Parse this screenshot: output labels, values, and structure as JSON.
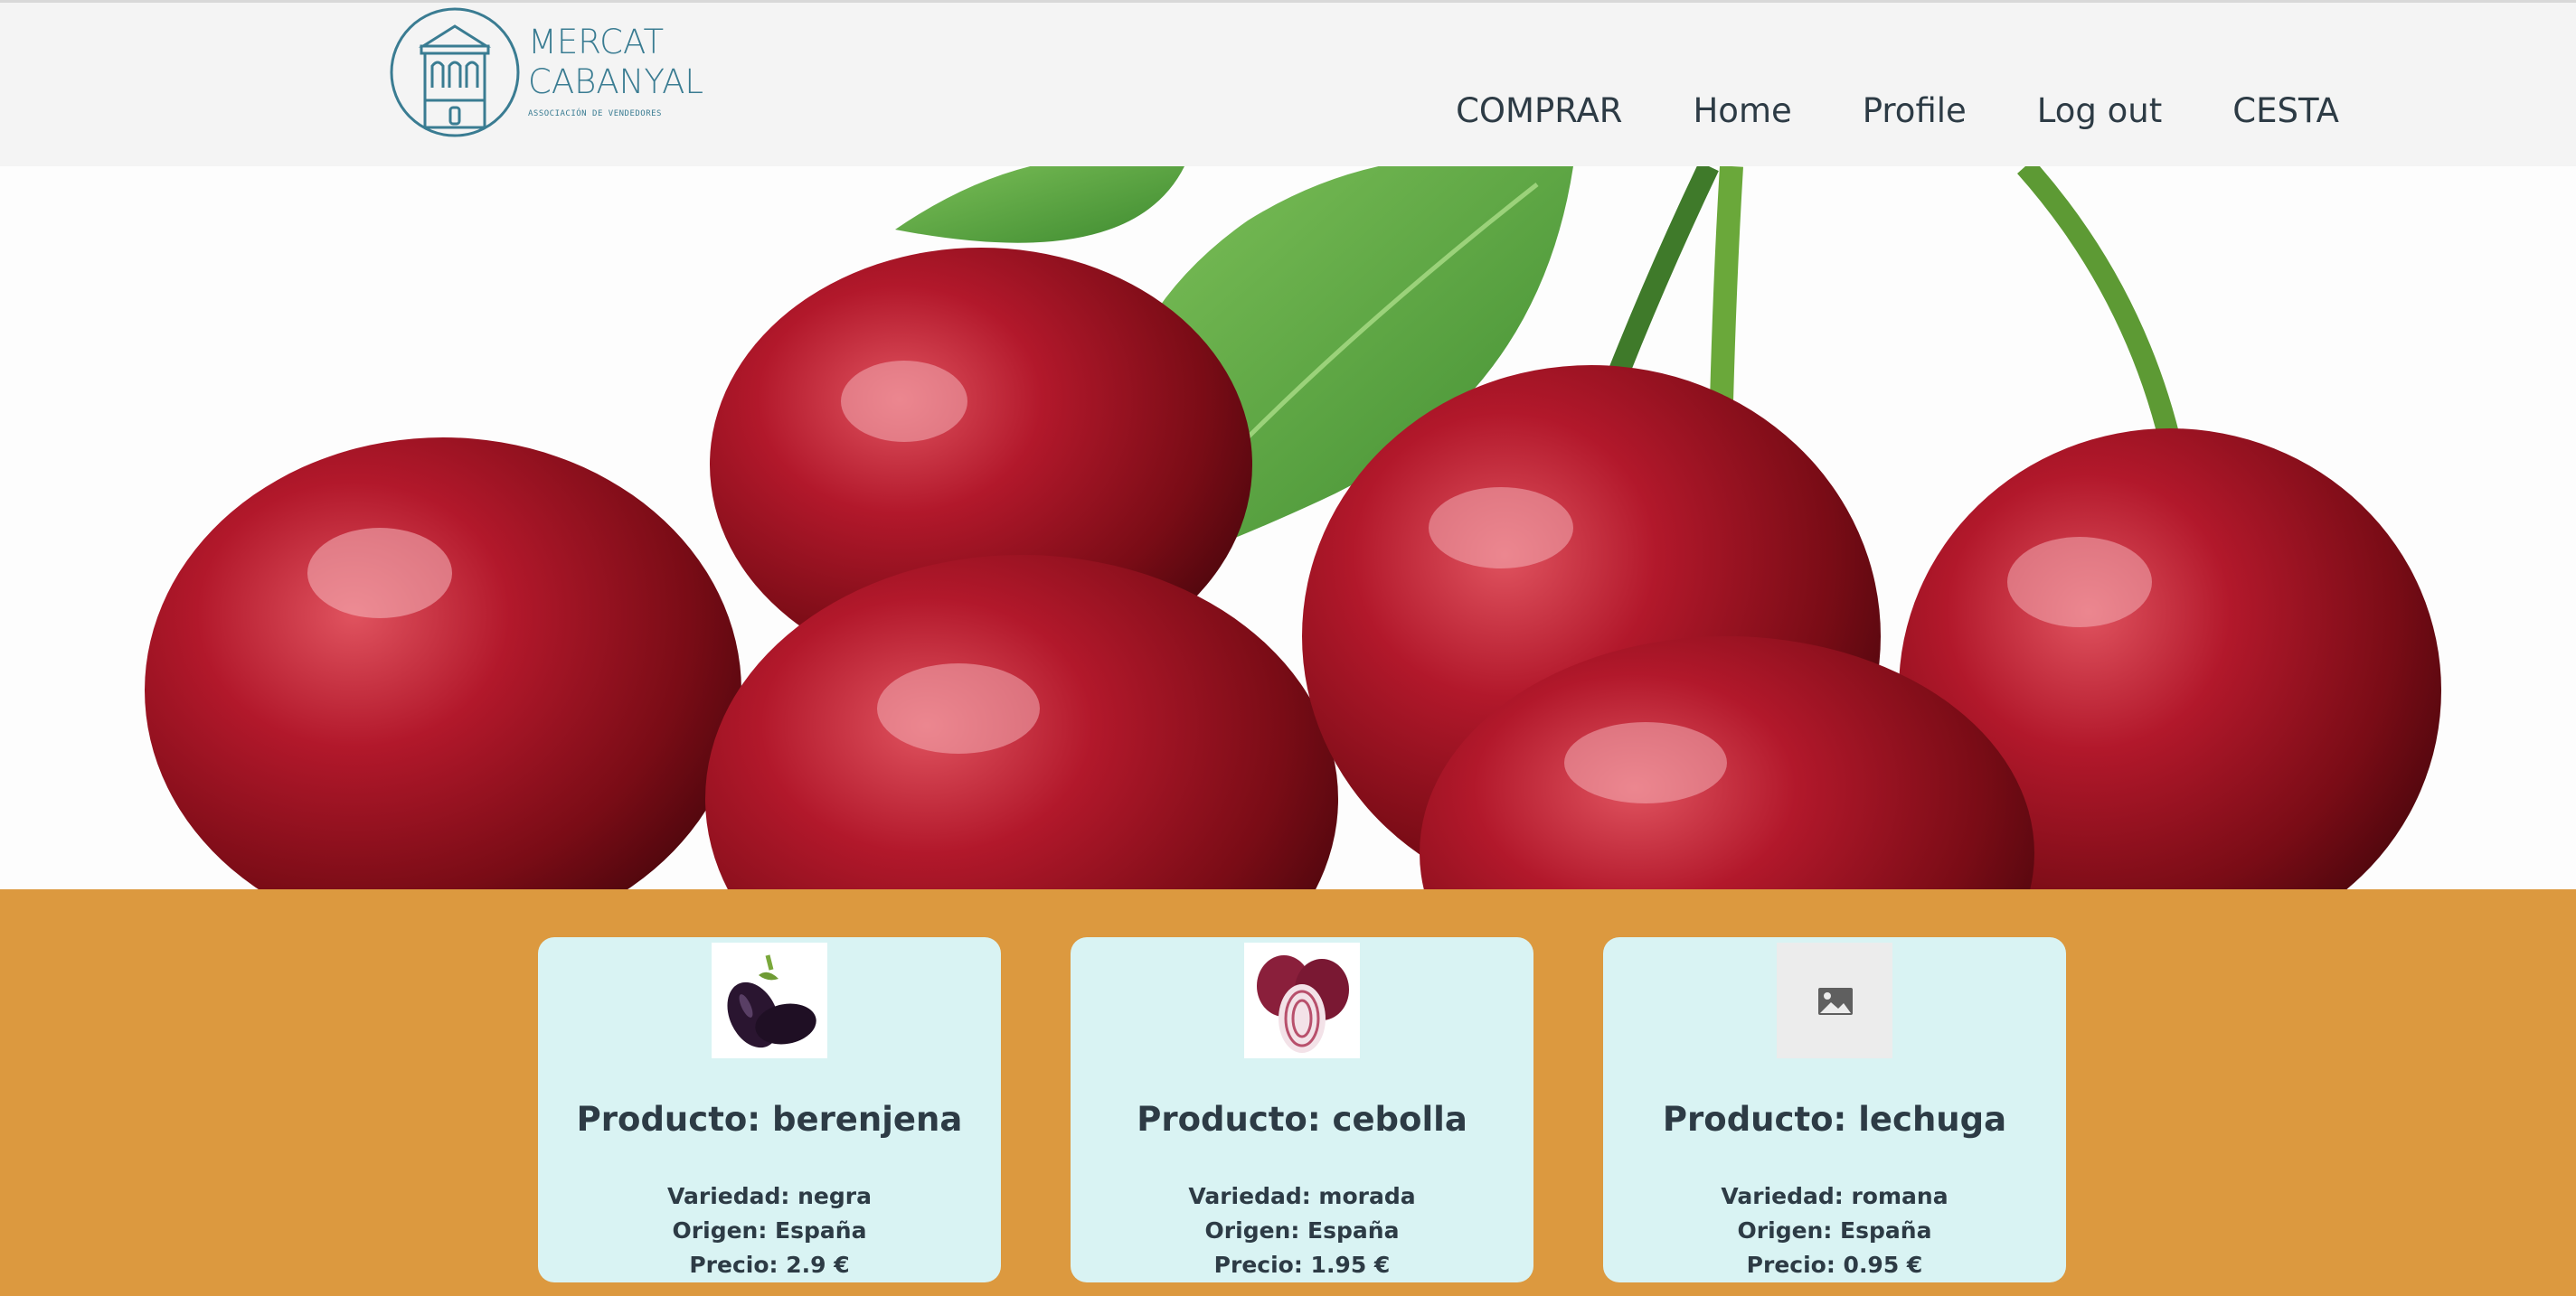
{
  "brand": {
    "line1": "MERCAT",
    "line2": "CABANYAL",
    "subtitle": "ASSOCIACIÓN DE VENDEDORES"
  },
  "nav": {
    "comprar": "COMPRAR",
    "home": "Home",
    "profile": "Profile",
    "logout": "Log out",
    "cesta": "CESTA"
  },
  "hero": {
    "image": "cherries-photo"
  },
  "products": [
    {
      "title": "Producto: berenjena",
      "variedad": "Variedad: negra",
      "origen": "Origen: España",
      "precio": "Precio: 2.9 €",
      "image": "eggplant-image"
    },
    {
      "title": "Producto: cebolla",
      "variedad": "Variedad: morada",
      "origen": "Origen: España",
      "precio": "Precio: 1.95 €",
      "image": "red-onion-image"
    },
    {
      "title": "Producto: lechuga",
      "variedad": "Variedad: romana",
      "origen": "Origen: España",
      "precio": "Precio: 0.95 €",
      "image": "image-placeholder-icon"
    }
  ],
  "colors": {
    "header_bg": "#f4f4f4",
    "brand_blue": "#3a7c92",
    "nav_text": "#2d3b45",
    "products_bg": "#dc993f",
    "card_bg": "#d9f3f3"
  }
}
